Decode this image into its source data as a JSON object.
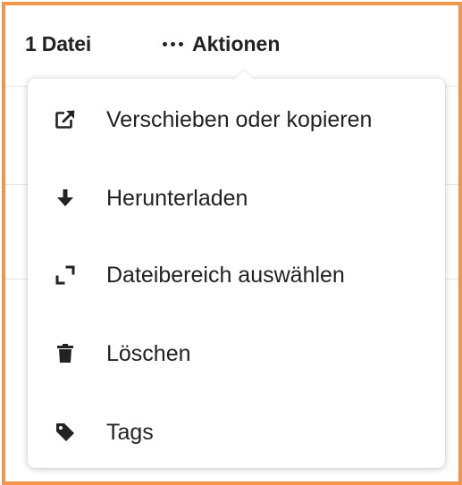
{
  "header": {
    "file_count": "1 Datei",
    "actions_label": "Aktionen"
  },
  "menu": {
    "items": [
      {
        "label": "Verschieben oder kopieren",
        "icon": "external-link-icon"
      },
      {
        "label": "Herunterladen",
        "icon": "arrow-down-icon"
      },
      {
        "label": "Dateibereich auswählen",
        "icon": "select-range-icon"
      },
      {
        "label": "Löschen",
        "icon": "trash-icon"
      },
      {
        "label": "Tags",
        "icon": "tag-icon"
      }
    ]
  },
  "colors": {
    "frame_border": "#f0954a",
    "text": "#222222"
  }
}
